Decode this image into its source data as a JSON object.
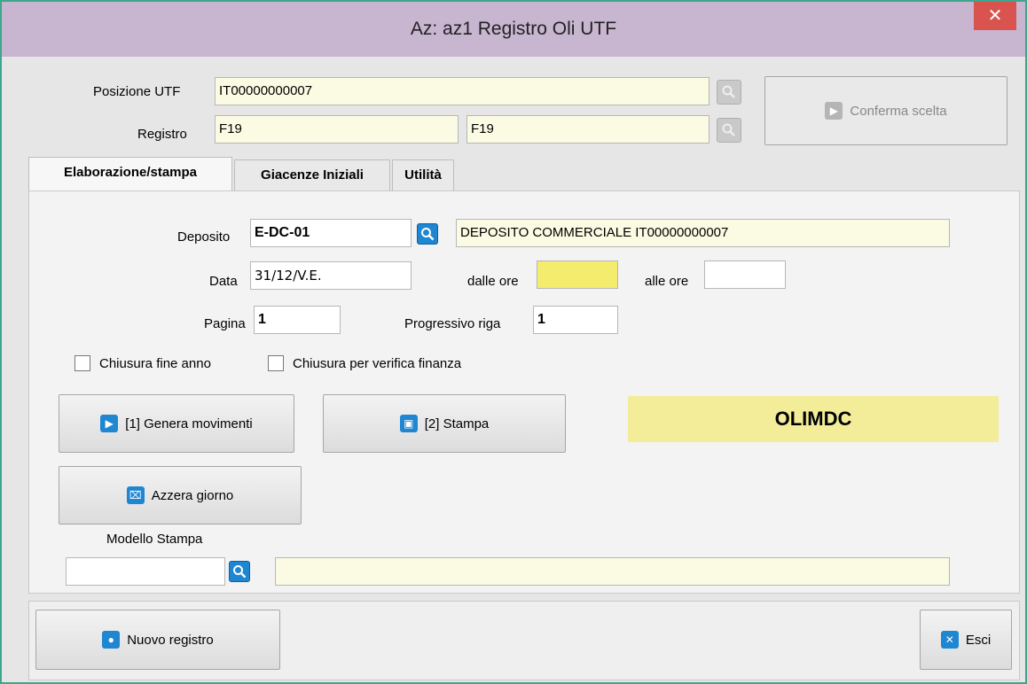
{
  "window": {
    "title": "Az: az1   Registro Oli UTF",
    "close_label": "✕"
  },
  "header": {
    "posizione_label": "Posizione UTF",
    "posizione_value": "IT00000000007",
    "registro_label": "Registro",
    "registro_value1": "F19",
    "registro_value2": "F19",
    "conferma_label": "Conferma scelta"
  },
  "tabs": [
    {
      "label": "Elaborazione/stampa"
    },
    {
      "label": "Giacenze Iniziali"
    },
    {
      "label": "Utilità"
    }
  ],
  "form": {
    "deposito_label": "Deposito",
    "deposito_code": "E-DC-01",
    "deposito_desc": "DEPOSITO COMMERCIALE IT00000000007",
    "data_label": "Data",
    "data_value": "31/12/V.E.",
    "dalle_ore_label": "dalle ore",
    "dalle_ore_value": "",
    "alle_ore_label": "alle ore",
    "alle_ore_value": "",
    "pagina_label": "Pagina",
    "pagina_value": "1",
    "progressivo_label": "Progressivo riga",
    "progressivo_value": "1",
    "chiusura_fine_anno_label": "Chiusura fine anno",
    "chiusura_verifica_label": "Chiusura per verifica finanza"
  },
  "actions": {
    "genera_label": "[1] Genera movimenti",
    "stampa_label": "[2] Stampa",
    "azzera_label": "Azzera giorno",
    "code_badge": "OLIMDC"
  },
  "modello": {
    "label": "Modello Stampa",
    "code_value": "",
    "desc_value": ""
  },
  "footer": {
    "nuovo_label": "Nuovo registro",
    "esci_label": "Esci"
  },
  "colors": {
    "accent": "#1f86d1",
    "title_bar": "#c8b5d0",
    "field_yellow": "#fbfbe3",
    "border": "#3fa58c"
  }
}
